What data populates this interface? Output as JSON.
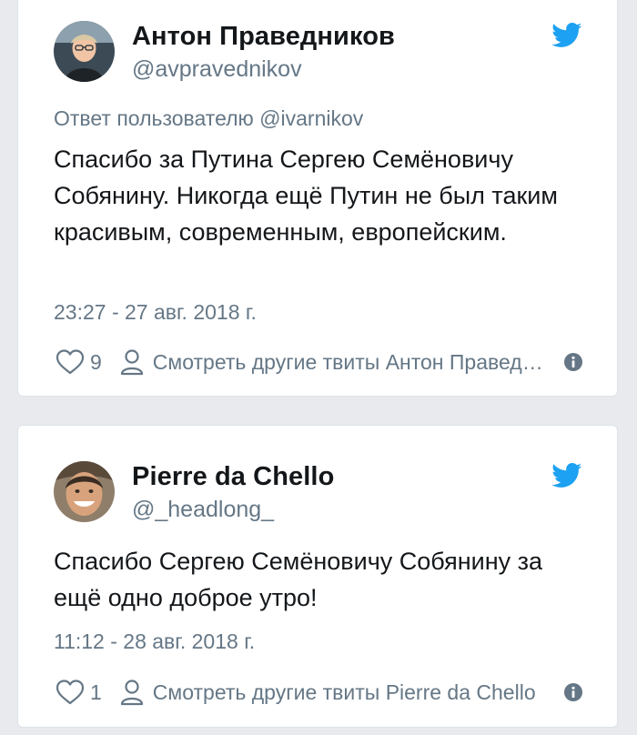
{
  "colors": {
    "background": "#e8eaed",
    "card": "#ffffff",
    "text": "#14171a",
    "secondary_text": "#657786",
    "twitter_blue": "#1da1f2"
  },
  "tweets": [
    {
      "author_name": "Антон Праведников",
      "author_handle": "@avpravednikov",
      "reply_context": "Ответ пользователю @ivarnikov",
      "text": "Спасибо за Путина Сергею Семёновичу Собянину. Никогда ещё Путин не был таким красивым, современным, европейским.",
      "timestamp": "23:27 - 27 авг. 2018 г.",
      "like_count": "9",
      "more_tweets_label": "Смотреть другие твиты Антон Праведников",
      "icons": {
        "avatar": "avatar",
        "brand": "twitter-bird-icon",
        "like": "heart-icon",
        "profile": "user-icon",
        "info": "info-icon"
      }
    },
    {
      "author_name": "Pierre da Chello",
      "author_handle": "@_headlong_",
      "text": "Спасибо Сергею Семёновичу Собянину за ещё одно доброе утро!",
      "timestamp": "11:12 - 28 авг. 2018 г.",
      "like_count": "1",
      "more_tweets_label": "Смотреть другие твиты Pierre da Chello",
      "icons": {
        "avatar": "avatar",
        "brand": "twitter-bird-icon",
        "like": "heart-icon",
        "profile": "user-icon",
        "info": "info-icon"
      }
    }
  ]
}
